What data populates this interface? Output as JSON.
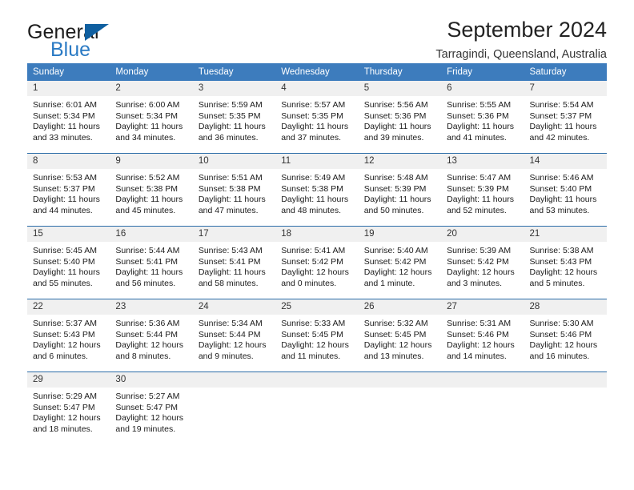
{
  "brand": {
    "name_top": "General",
    "name_bottom": "Blue",
    "triangle_color": "#0f5fa0",
    "blue_text_color": "#2a7ac4"
  },
  "header": {
    "title": "September 2024",
    "subtitle": "Tarragindi, Queensland, Australia"
  },
  "theme": {
    "header_row_bg": "#3d7cbd",
    "day_number_bg": "#f0f0f0",
    "row_divider": "#2b6ca8",
    "page_bg": "#ffffff"
  },
  "weekdays": [
    "Sunday",
    "Monday",
    "Tuesday",
    "Wednesday",
    "Thursday",
    "Friday",
    "Saturday"
  ],
  "weeks": [
    [
      {
        "day": "1",
        "sunrise": "Sunrise: 6:01 AM",
        "sunset": "Sunset: 5:34 PM",
        "daylight1": "Daylight: 11 hours",
        "daylight2": "and 33 minutes."
      },
      {
        "day": "2",
        "sunrise": "Sunrise: 6:00 AM",
        "sunset": "Sunset: 5:34 PM",
        "daylight1": "Daylight: 11 hours",
        "daylight2": "and 34 minutes."
      },
      {
        "day": "3",
        "sunrise": "Sunrise: 5:59 AM",
        "sunset": "Sunset: 5:35 PM",
        "daylight1": "Daylight: 11 hours",
        "daylight2": "and 36 minutes."
      },
      {
        "day": "4",
        "sunrise": "Sunrise: 5:57 AM",
        "sunset": "Sunset: 5:35 PM",
        "daylight1": "Daylight: 11 hours",
        "daylight2": "and 37 minutes."
      },
      {
        "day": "5",
        "sunrise": "Sunrise: 5:56 AM",
        "sunset": "Sunset: 5:36 PM",
        "daylight1": "Daylight: 11 hours",
        "daylight2": "and 39 minutes."
      },
      {
        "day": "6",
        "sunrise": "Sunrise: 5:55 AM",
        "sunset": "Sunset: 5:36 PM",
        "daylight1": "Daylight: 11 hours",
        "daylight2": "and 41 minutes."
      },
      {
        "day": "7",
        "sunrise": "Sunrise: 5:54 AM",
        "sunset": "Sunset: 5:37 PM",
        "daylight1": "Daylight: 11 hours",
        "daylight2": "and 42 minutes."
      }
    ],
    [
      {
        "day": "8",
        "sunrise": "Sunrise: 5:53 AM",
        "sunset": "Sunset: 5:37 PM",
        "daylight1": "Daylight: 11 hours",
        "daylight2": "and 44 minutes."
      },
      {
        "day": "9",
        "sunrise": "Sunrise: 5:52 AM",
        "sunset": "Sunset: 5:38 PM",
        "daylight1": "Daylight: 11 hours",
        "daylight2": "and 45 minutes."
      },
      {
        "day": "10",
        "sunrise": "Sunrise: 5:51 AM",
        "sunset": "Sunset: 5:38 PM",
        "daylight1": "Daylight: 11 hours",
        "daylight2": "and 47 minutes."
      },
      {
        "day": "11",
        "sunrise": "Sunrise: 5:49 AM",
        "sunset": "Sunset: 5:38 PM",
        "daylight1": "Daylight: 11 hours",
        "daylight2": "and 48 minutes."
      },
      {
        "day": "12",
        "sunrise": "Sunrise: 5:48 AM",
        "sunset": "Sunset: 5:39 PM",
        "daylight1": "Daylight: 11 hours",
        "daylight2": "and 50 minutes."
      },
      {
        "day": "13",
        "sunrise": "Sunrise: 5:47 AM",
        "sunset": "Sunset: 5:39 PM",
        "daylight1": "Daylight: 11 hours",
        "daylight2": "and 52 minutes."
      },
      {
        "day": "14",
        "sunrise": "Sunrise: 5:46 AM",
        "sunset": "Sunset: 5:40 PM",
        "daylight1": "Daylight: 11 hours",
        "daylight2": "and 53 minutes."
      }
    ],
    [
      {
        "day": "15",
        "sunrise": "Sunrise: 5:45 AM",
        "sunset": "Sunset: 5:40 PM",
        "daylight1": "Daylight: 11 hours",
        "daylight2": "and 55 minutes."
      },
      {
        "day": "16",
        "sunrise": "Sunrise: 5:44 AM",
        "sunset": "Sunset: 5:41 PM",
        "daylight1": "Daylight: 11 hours",
        "daylight2": "and 56 minutes."
      },
      {
        "day": "17",
        "sunrise": "Sunrise: 5:43 AM",
        "sunset": "Sunset: 5:41 PM",
        "daylight1": "Daylight: 11 hours",
        "daylight2": "and 58 minutes."
      },
      {
        "day": "18",
        "sunrise": "Sunrise: 5:41 AM",
        "sunset": "Sunset: 5:42 PM",
        "daylight1": "Daylight: 12 hours",
        "daylight2": "and 0 minutes."
      },
      {
        "day": "19",
        "sunrise": "Sunrise: 5:40 AM",
        "sunset": "Sunset: 5:42 PM",
        "daylight1": "Daylight: 12 hours",
        "daylight2": "and 1 minute."
      },
      {
        "day": "20",
        "sunrise": "Sunrise: 5:39 AM",
        "sunset": "Sunset: 5:42 PM",
        "daylight1": "Daylight: 12 hours",
        "daylight2": "and 3 minutes."
      },
      {
        "day": "21",
        "sunrise": "Sunrise: 5:38 AM",
        "sunset": "Sunset: 5:43 PM",
        "daylight1": "Daylight: 12 hours",
        "daylight2": "and 5 minutes."
      }
    ],
    [
      {
        "day": "22",
        "sunrise": "Sunrise: 5:37 AM",
        "sunset": "Sunset: 5:43 PM",
        "daylight1": "Daylight: 12 hours",
        "daylight2": "and 6 minutes."
      },
      {
        "day": "23",
        "sunrise": "Sunrise: 5:36 AM",
        "sunset": "Sunset: 5:44 PM",
        "daylight1": "Daylight: 12 hours",
        "daylight2": "and 8 minutes."
      },
      {
        "day": "24",
        "sunrise": "Sunrise: 5:34 AM",
        "sunset": "Sunset: 5:44 PM",
        "daylight1": "Daylight: 12 hours",
        "daylight2": "and 9 minutes."
      },
      {
        "day": "25",
        "sunrise": "Sunrise: 5:33 AM",
        "sunset": "Sunset: 5:45 PM",
        "daylight1": "Daylight: 12 hours",
        "daylight2": "and 11 minutes."
      },
      {
        "day": "26",
        "sunrise": "Sunrise: 5:32 AM",
        "sunset": "Sunset: 5:45 PM",
        "daylight1": "Daylight: 12 hours",
        "daylight2": "and 13 minutes."
      },
      {
        "day": "27",
        "sunrise": "Sunrise: 5:31 AM",
        "sunset": "Sunset: 5:46 PM",
        "daylight1": "Daylight: 12 hours",
        "daylight2": "and 14 minutes."
      },
      {
        "day": "28",
        "sunrise": "Sunrise: 5:30 AM",
        "sunset": "Sunset: 5:46 PM",
        "daylight1": "Daylight: 12 hours",
        "daylight2": "and 16 minutes."
      }
    ],
    [
      {
        "day": "29",
        "sunrise": "Sunrise: 5:29 AM",
        "sunset": "Sunset: 5:47 PM",
        "daylight1": "Daylight: 12 hours",
        "daylight2": "and 18 minutes."
      },
      {
        "day": "30",
        "sunrise": "Sunrise: 5:27 AM",
        "sunset": "Sunset: 5:47 PM",
        "daylight1": "Daylight: 12 hours",
        "daylight2": "and 19 minutes."
      },
      {
        "day": "",
        "sunrise": "",
        "sunset": "",
        "daylight1": "",
        "daylight2": ""
      },
      {
        "day": "",
        "sunrise": "",
        "sunset": "",
        "daylight1": "",
        "daylight2": ""
      },
      {
        "day": "",
        "sunrise": "",
        "sunset": "",
        "daylight1": "",
        "daylight2": ""
      },
      {
        "day": "",
        "sunrise": "",
        "sunset": "",
        "daylight1": "",
        "daylight2": ""
      },
      {
        "day": "",
        "sunrise": "",
        "sunset": "",
        "daylight1": "",
        "daylight2": ""
      }
    ]
  ]
}
